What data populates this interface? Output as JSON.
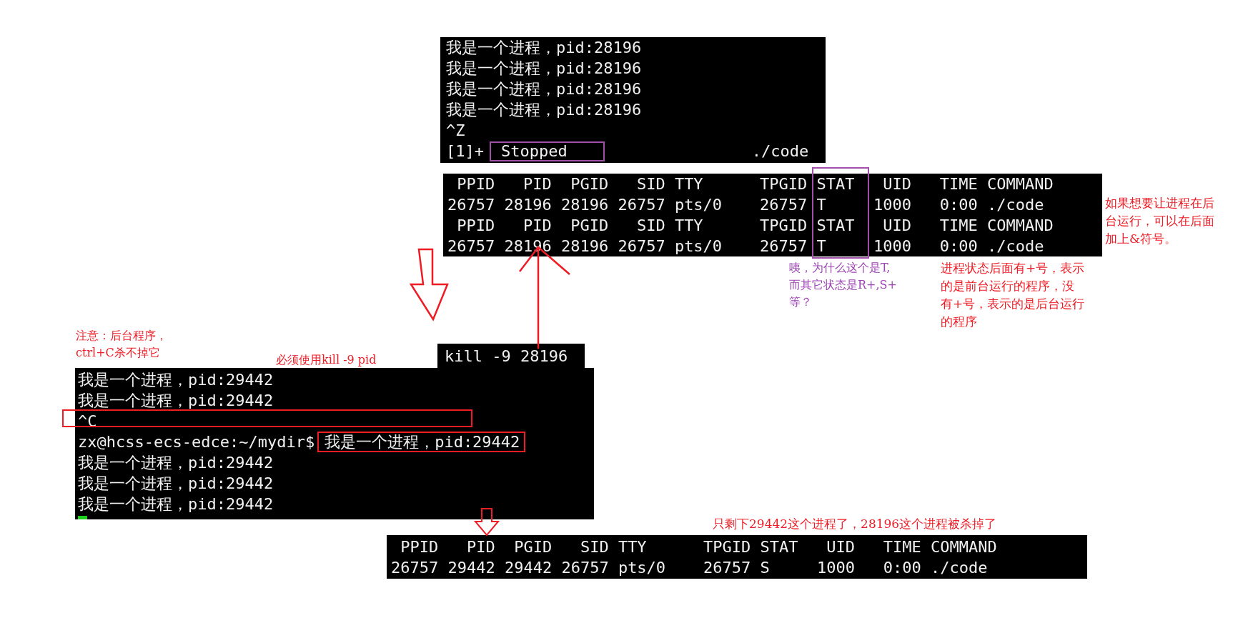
{
  "top_terminal": {
    "lines": [
      "我是一个进程，pid:28196",
      "我是一个进程，pid:28196",
      "我是一个进程，pid:28196",
      "我是一个进程，pid:28196",
      "^Z"
    ],
    "job_line": {
      "job": "[1]+",
      "status": "Stopped",
      "command": "./code"
    }
  },
  "ps_table": {
    "rows": [
      " PPID   PID  PGID   SID TTY      TPGID STAT   UID   TIME COMMAND",
      "26757 28196 28196 26757 pts/0    26757 T     1000   0:00 ./code",
      " PPID   PID  PGID   SID TTY      TPGID STAT   UID   TIME COMMAND",
      "26757 28196 28196 26757 pts/0    26757 T     1000   0:00 ./code"
    ]
  },
  "kill_command": "kill -9 28196",
  "bottom_terminal": {
    "lines": [
      {
        "kind": "output",
        "text": "我是一个进程，pid:29442"
      },
      {
        "kind": "output",
        "text": "我是一个进程，pid:29442"
      },
      {
        "kind": "output",
        "text": "^C"
      },
      {
        "kind": "prompt",
        "prompt": "zx@hcss-ecs-edce:~/mydir$",
        "text": "我是一个进程，pid:29442"
      },
      {
        "kind": "output",
        "text": "我是一个进程，pid:29442"
      },
      {
        "kind": "output",
        "text": "我是一个进程，pid:29442"
      },
      {
        "kind": "output",
        "text": "我是一个进程，pid:29442"
      }
    ],
    "cursor": true
  },
  "result_table": {
    "rows": [
      " PPID   PID  PGID   SID TTY      TPGID STAT   UID   TIME COMMAND",
      "26757 29442 29442 26757 pts/0    26757 S     1000   0:00 ./code"
    ]
  },
  "notes": [
    {
      "kind": "right",
      "color": "#ee1c25",
      "lines": [
        "如果想要让进程在后",
        "台运行，可以在后面",
        "加上&符号。"
      ]
    },
    {
      "kind": "stat",
      "color": "#9d44b5",
      "lines": [
        "咦，为什么这个是T,",
        "而其它状态是R+,S+",
        "等？"
      ]
    },
    {
      "kind": "plus",
      "color": "#ee1c25",
      "lines": [
        "进程状态后面有+号，表示",
        "的是前台运行的程序，没",
        "有+号，表示的是后台运行",
        "的程序"
      ]
    },
    {
      "kind": "ctrlc",
      "color": "#ee1c25",
      "lines": [
        "注意：后台程序，",
        "ctrl+C杀不掉它"
      ]
    },
    {
      "kind": "kill",
      "color": "#ee1c25",
      "lines": [
        "必须使用kill -9 pid"
      ]
    },
    {
      "kind": "result",
      "color": "#ee1c25",
      "lines": [
        "只剩下29442这个进程了，28196这个进程被杀掉了"
      ]
    }
  ]
}
